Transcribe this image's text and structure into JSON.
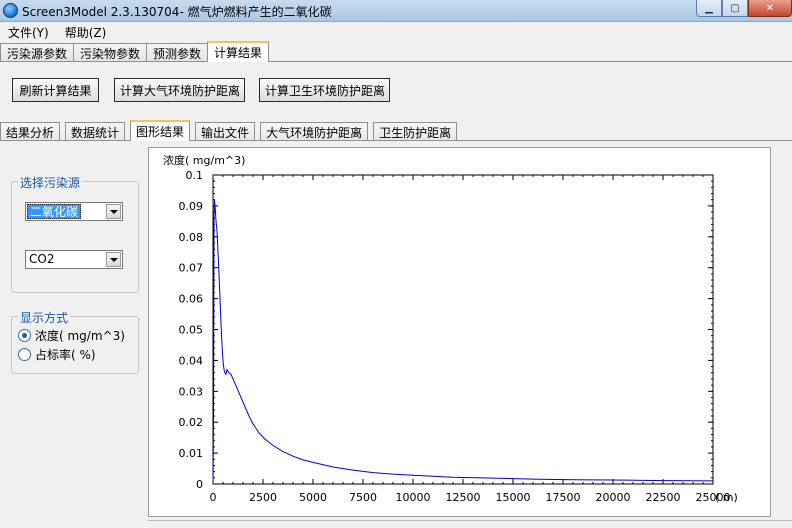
{
  "window": {
    "title": "Screen3Model 2.3.130704- 燃气炉燃料产生的二氧化碳"
  },
  "menu": [
    "文件(Y)",
    "帮助(Z)"
  ],
  "main_tabs": [
    "污染源参数",
    "污染物参数",
    "预测参数",
    "计算结果"
  ],
  "buttons": {
    "refresh": "刷新计算结果",
    "atm_distance": "计算大气环境防护距离",
    "health_distance": "计算卫生环境防护距离"
  },
  "sub_tabs": [
    "结果分析",
    "数据统计",
    "图形结果",
    "输出文件",
    "大气环境防护距离",
    "卫生防护距离"
  ],
  "source_group": {
    "label": "选择污染源",
    "source_value": "二氧化碳",
    "pollutant_value": "CO2"
  },
  "display_group": {
    "label": "显示方式",
    "options": [
      "浓度( mg/m^3)",
      "占标率( %)"
    ],
    "selected": 0
  },
  "colors": {
    "line": "#0000cc",
    "accent": "#1a56a8"
  },
  "chart_data": {
    "type": "line",
    "ylabel": "浓度( mg/m^3)",
    "xlabel": "( m)",
    "xlim": [
      0,
      25000
    ],
    "ylim": [
      0,
      0.1
    ],
    "xticks": [
      0,
      2500,
      5000,
      7500,
      10000,
      12500,
      15000,
      17500,
      20000,
      22500,
      25000
    ],
    "yticks": [
      0,
      0.01,
      0.02,
      0.03,
      0.04,
      0.05,
      0.06,
      0.07,
      0.08,
      0.09,
      0.1
    ],
    "grid": false,
    "series": [
      {
        "x": [
          0,
          25,
          50,
          75,
          100,
          125,
          150,
          200,
          250,
          300,
          350,
          400,
          450,
          500,
          550,
          600,
          650,
          700,
          800,
          900,
          1000,
          1200,
          1400,
          1600,
          1800,
          2000,
          2300,
          2600,
          3000,
          3500,
          4000,
          4500,
          5000,
          6000,
          7000,
          8000,
          9000,
          10000,
          12000,
          14000,
          16000,
          18000,
          20000,
          22500,
          25000
        ],
        "y": [
          0.0,
          0.02,
          0.085,
          0.092,
          0.09,
          0.088,
          0.085,
          0.082,
          0.075,
          0.068,
          0.06,
          0.052,
          0.045,
          0.04,
          0.037,
          0.036,
          0.0355,
          0.037,
          0.036,
          0.0355,
          0.034,
          0.031,
          0.028,
          0.025,
          0.022,
          0.0195,
          0.0165,
          0.0145,
          0.0125,
          0.0105,
          0.009,
          0.0078,
          0.007,
          0.0055,
          0.0045,
          0.0037,
          0.0032,
          0.0028,
          0.0022,
          0.0019,
          0.0016,
          0.0014,
          0.0013,
          0.0011,
          0.001
        ]
      }
    ]
  }
}
